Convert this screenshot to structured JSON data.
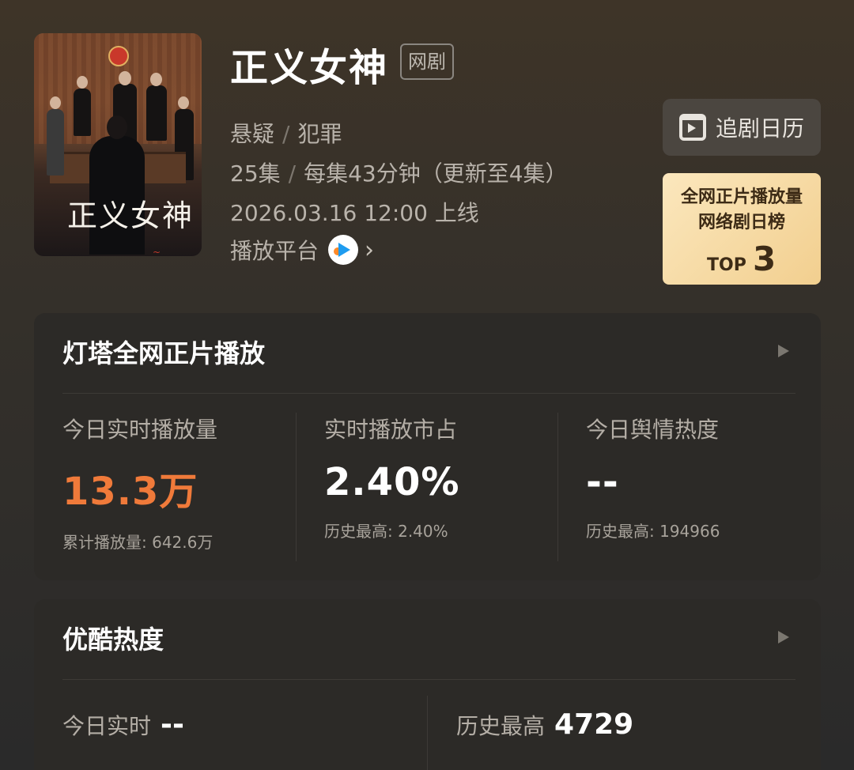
{
  "show": {
    "title": "正义女神",
    "type_badge": "网剧",
    "poster_title": "正义女神",
    "genre_1": "悬疑",
    "genre_sep": "/",
    "genre_2": "犯罪",
    "episodes": "25集",
    "episode_info": "每集43分钟（更新至4集）",
    "release": "2026.03.16 12:00 上线",
    "platform_label": "播放平台",
    "platform_icon": "youku-logo-icon",
    "more_icon": "chevron-right-icon"
  },
  "calendar_button": {
    "label": "追剧日历",
    "icon": "calendar-play-icon"
  },
  "ranking": {
    "line1": "全网正片播放量",
    "line2": "网络剧日榜",
    "top_label": "TOP",
    "top_number": "3"
  },
  "panel_playback": {
    "title": "灯塔全网正片播放",
    "stats": [
      {
        "label": "今日实时播放量",
        "value": "13.3万",
        "sub": "累计播放量: 642.6万"
      },
      {
        "label": "实时播放市占",
        "value": "2.40%",
        "sub": "历史最高: 2.40%"
      },
      {
        "label": "今日舆情热度",
        "value": "--",
        "sub": "历史最高: 194966"
      }
    ]
  },
  "panel_youku": {
    "title": "优酷热度",
    "today_label": "今日实时",
    "today_value": "--",
    "history_label": "历史最高",
    "history_value": "4729"
  },
  "colors": {
    "accent_orange": "#f07a3a",
    "badge_gold": "#f2cf8f",
    "panel_bg": "#2c2a27"
  }
}
